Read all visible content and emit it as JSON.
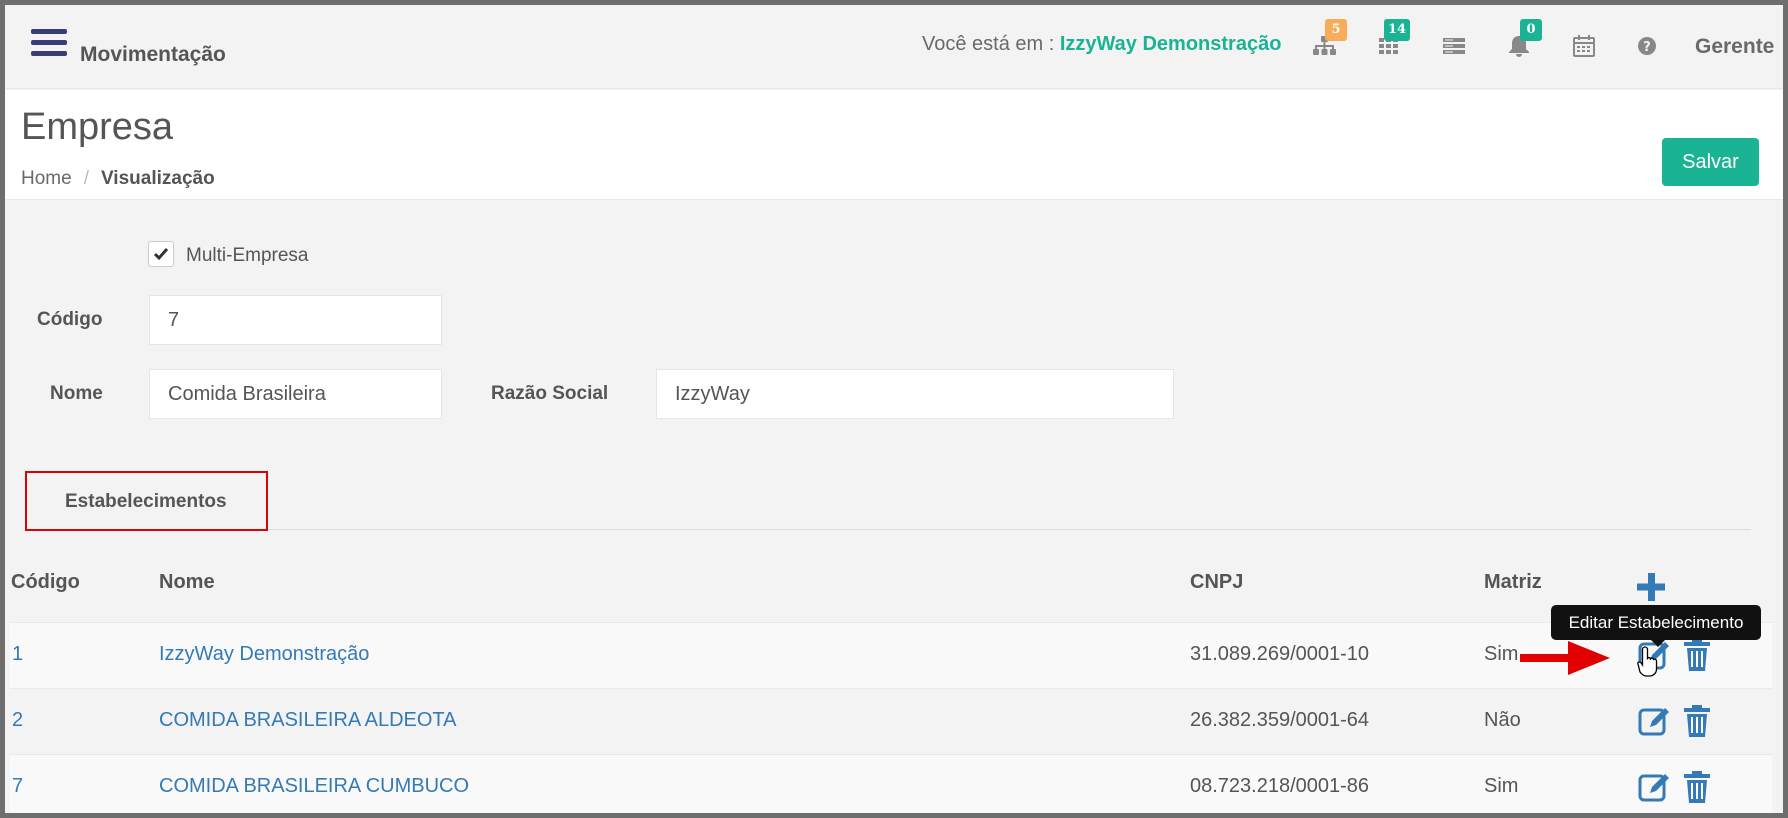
{
  "header": {
    "app_title": "Movimentação",
    "location_prefix": "Você está em : ",
    "location_company": "IzzyWay Demonstração",
    "user": "Gerente",
    "icons": [
      {
        "name": "sitemap-icon",
        "badge": "5",
        "badge_color": "#f8ac59"
      },
      {
        "name": "grid-icon",
        "badge": "14",
        "badge_color": "#1ab394"
      },
      {
        "name": "server-icon",
        "badge": "",
        "badge_color": ""
      },
      {
        "name": "bell-icon",
        "badge": "0",
        "badge_color": "#1ab394"
      },
      {
        "name": "calendar-icon",
        "badge": "",
        "badge_color": ""
      },
      {
        "name": "help-icon",
        "badge": "",
        "badge_color": ""
      }
    ]
  },
  "page": {
    "title": "Empresa",
    "breadcrumb_home": "Home",
    "breadcrumb_separator": "/",
    "breadcrumb_current": "Visualização",
    "save_label": "Salvar"
  },
  "form": {
    "multi_empresa_label": "Multi-Empresa",
    "multi_empresa_checked": true,
    "codigo_label": "Código",
    "codigo_value": "7",
    "nome_label": "Nome",
    "nome_value": "Comida Brasileira",
    "razao_label": "Razão Social",
    "razao_value": "IzzyWay"
  },
  "tabs": {
    "estabelecimentos": "Estabelecimentos"
  },
  "table": {
    "headers": {
      "codigo": "Código",
      "nome": "Nome",
      "cnpj": "CNPJ",
      "matriz": "Matriz"
    },
    "rows": [
      {
        "codigo": "1",
        "nome": "IzzyWay Demonstração",
        "cnpj": "31.089.269/0001-10",
        "matriz": "Sim"
      },
      {
        "codigo": "2",
        "nome": "COMIDA BRASILEIRA ALDEOTA",
        "cnpj": "26.382.359/0001-64",
        "matriz": "Não"
      },
      {
        "codigo": "7",
        "nome": "COMIDA BRASILEIRA CUMBUCO",
        "cnpj": "08.723.218/0001-86",
        "matriz": "Sim"
      }
    ],
    "tooltip": "Editar Estabelecimento"
  },
  "colors": {
    "accent": "#1ab394",
    "link": "#337ab7",
    "action": "#337ab7",
    "highlight": "#e00000"
  }
}
